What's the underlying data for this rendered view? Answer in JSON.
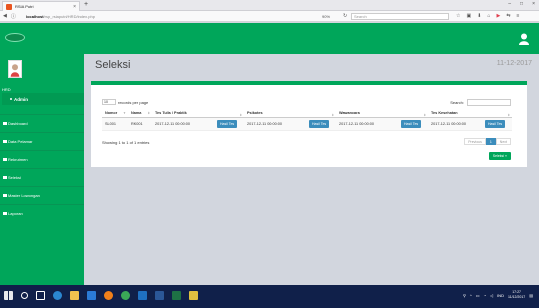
{
  "browser": {
    "tab_title": "RSIA Putri",
    "tab_close": "×",
    "new_tab": "+",
    "url_host": "localhost",
    "url_path": "/rsp_rsiaputri/HRD/index.php",
    "zoom": "90%",
    "search_placeholder": "Search",
    "window_controls": [
      "–",
      "□",
      "×"
    ]
  },
  "sidebar": {
    "role": "HRD",
    "user": "Admin",
    "items": [
      {
        "label": "Dashboard"
      },
      {
        "label": "Data Pelamar"
      },
      {
        "label": "Rekrutmen"
      },
      {
        "label": "Seleksi"
      },
      {
        "label": "Master Lowongan"
      },
      {
        "label": "Laporan"
      }
    ]
  },
  "page": {
    "title": "Seleksi",
    "date": "11-12-2017",
    "length_value": "10",
    "length_label": "records per page",
    "search_label": "Search:",
    "columns": [
      "Nomor",
      "Nama",
      "Tes Tulis / Praktik",
      "",
      "Psikotes",
      "",
      "Wawancara",
      "",
      "Tes Kesehatan",
      ""
    ],
    "rows": [
      {
        "nomor": "SL001",
        "nama": "RK001",
        "tes_tulis": "2017-12-11 00:00:00",
        "psikotes": "2017-12-11 00:00:00",
        "wawancara": "2017-12-11 00:00:00",
        "kesehatan": "2017-12-11 00:00:00"
      }
    ],
    "hasil_label": "Hasil Tes",
    "info": "Showing 1 to 1 of 1 entries",
    "pager": {
      "prev": "Previous",
      "page": "1",
      "next": "Next"
    },
    "select_button": "Seleksi »"
  },
  "taskbar": {
    "lang": "IND",
    "time": "17:27",
    "date": "11/12/2017"
  },
  "colors": {
    "accent": "#00a65a",
    "button": "#3c8dbc"
  }
}
